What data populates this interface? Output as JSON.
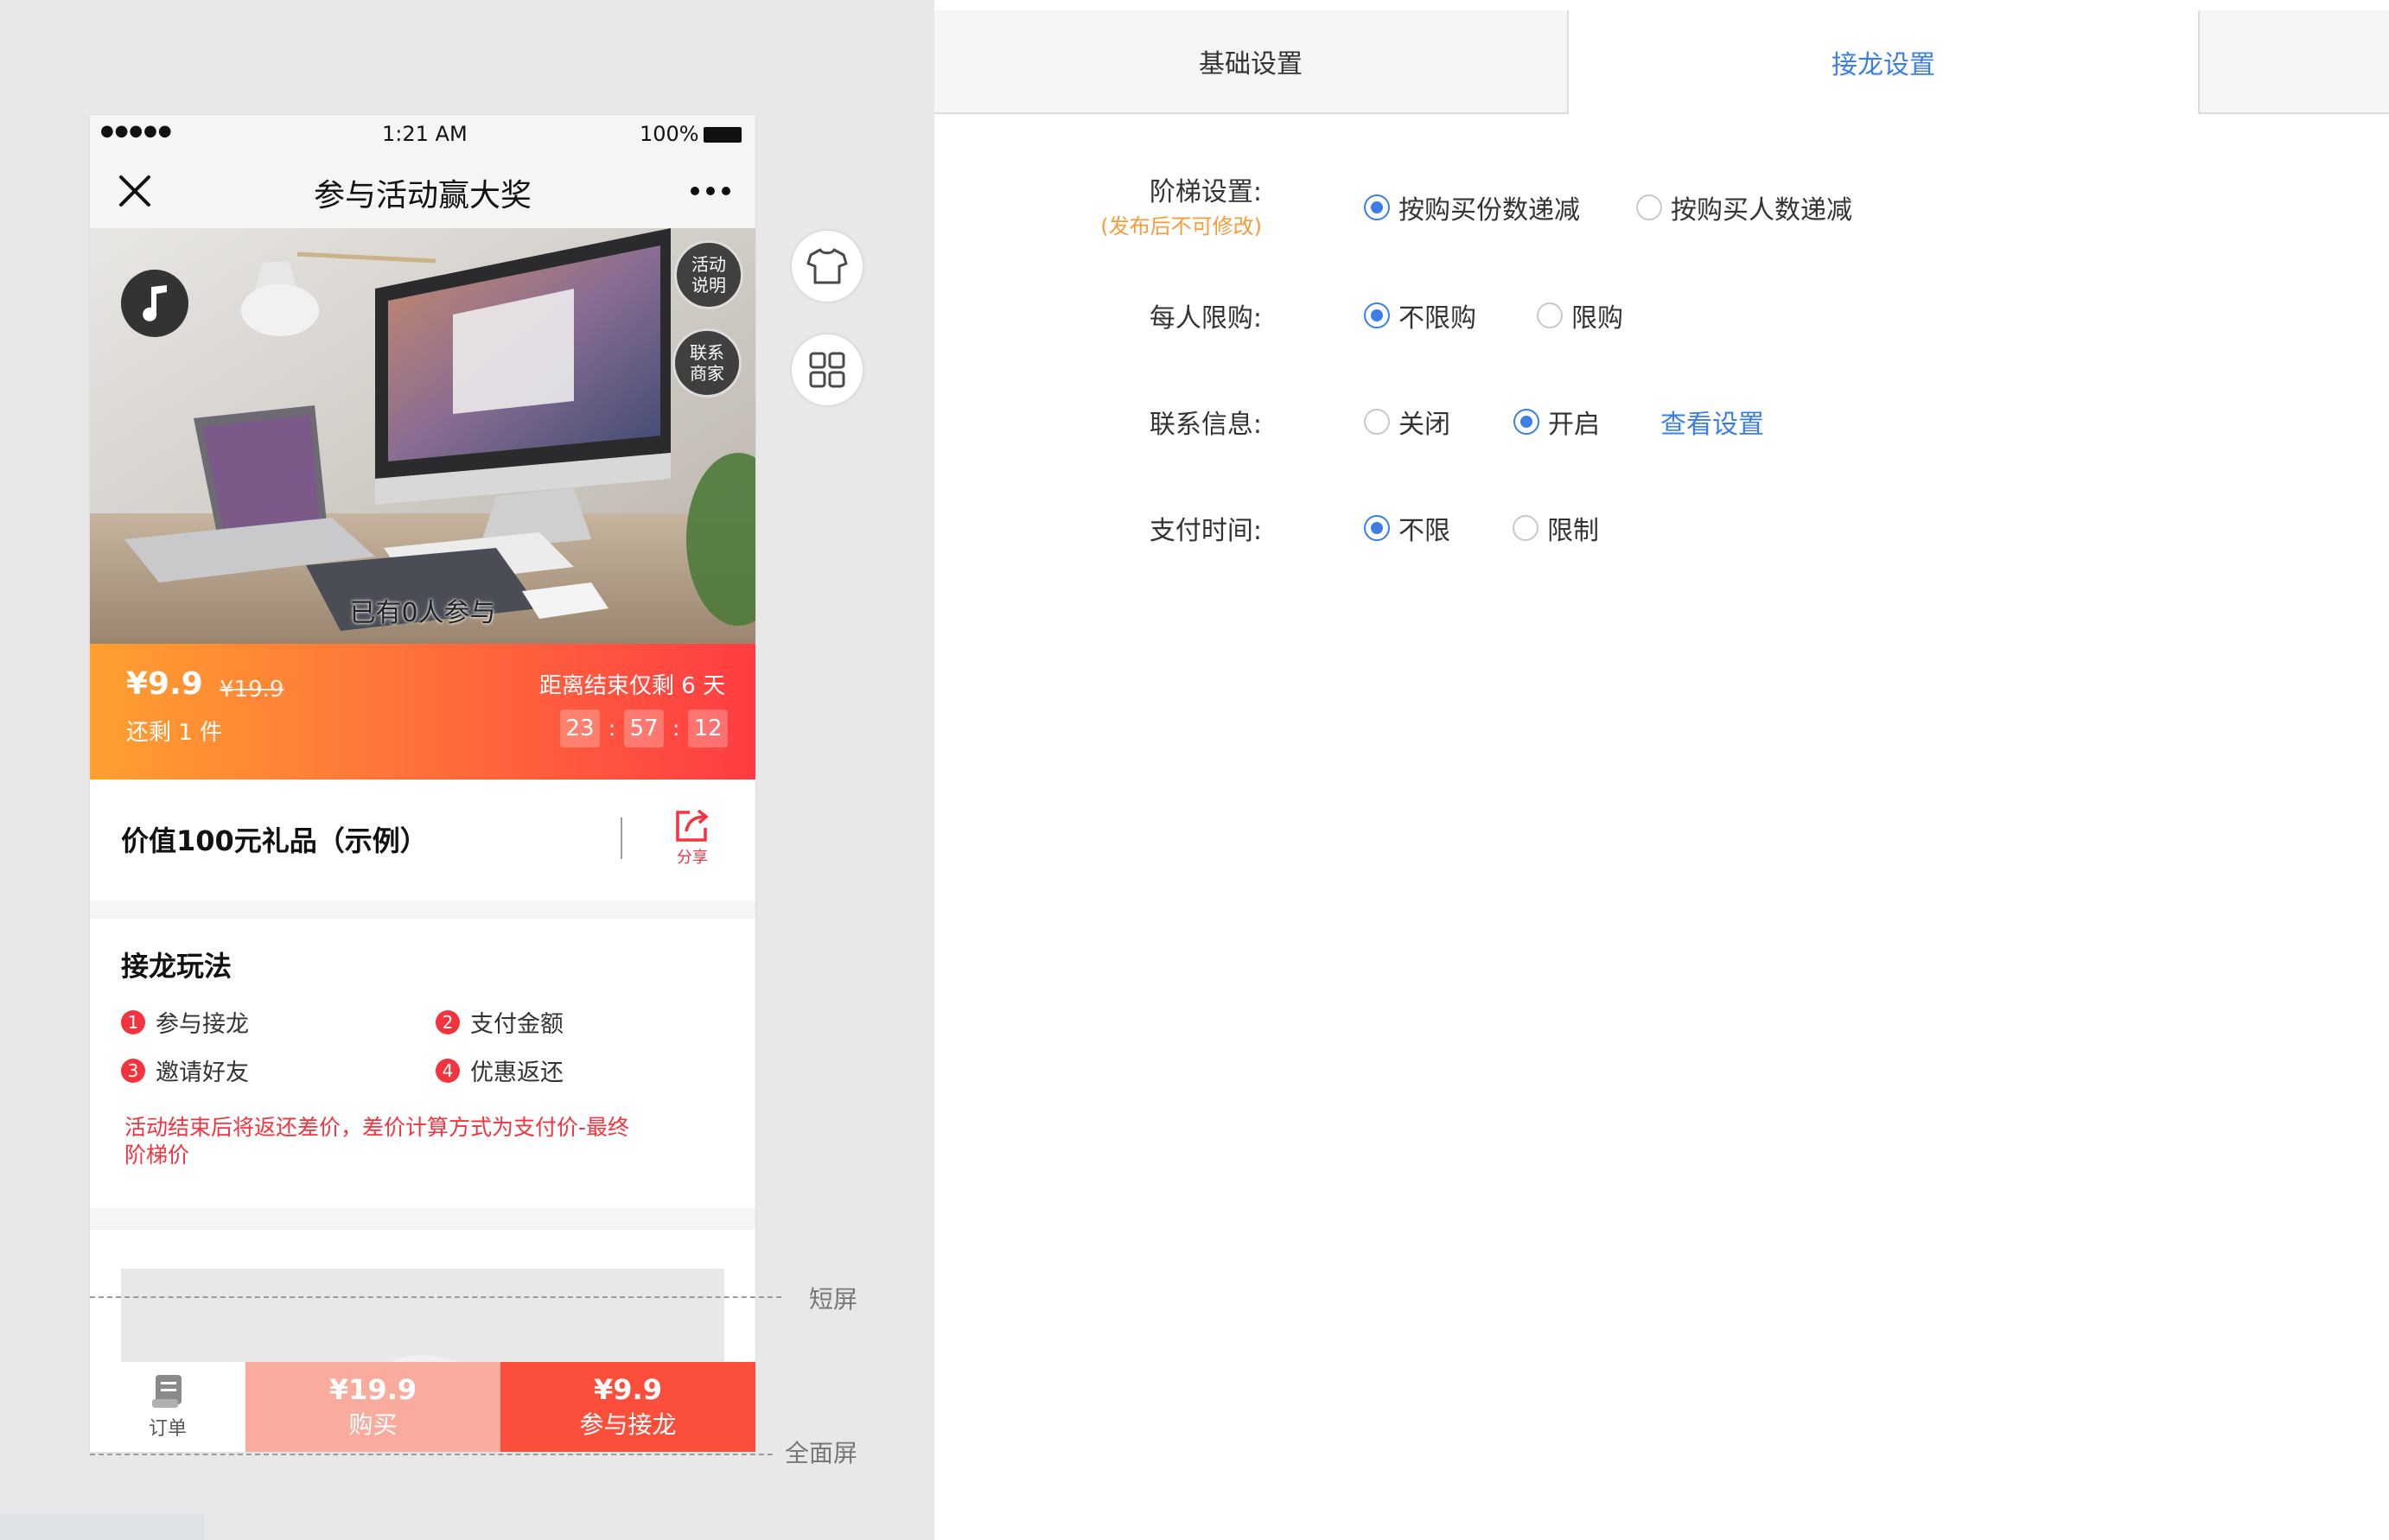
{
  "status_bar": {
    "signal": "●●●●●",
    "time": "1:21 AM",
    "battery": "100%"
  },
  "nav": {
    "title": "参与活动赢大奖",
    "close_icon": "close-icon",
    "more_icon": "more-icon"
  },
  "hero": {
    "badge_activity": [
      "活动",
      "说明"
    ],
    "badge_contact": [
      "联系",
      "商家"
    ],
    "participants": "已有0人参与"
  },
  "price_bar": {
    "price": "¥9.9",
    "original_price": "¥19.9",
    "remaining": "还剩 1 件",
    "countdown_label": "距离结束仅剩 6 天",
    "hours": "23",
    "minutes": "57",
    "seconds": "12",
    "sep": ":"
  },
  "product": {
    "title": "价值100元礼品（示例）",
    "share_label": "分享"
  },
  "rules": {
    "heading": "接龙玩法",
    "steps": [
      {
        "n": "1",
        "label": "参与接龙"
      },
      {
        "n": "2",
        "label": "支付金额"
      },
      {
        "n": "3",
        "label": "邀请好友"
      },
      {
        "n": "4",
        "label": "优惠返还"
      }
    ],
    "note_line1": "活动结束后将返还差价，差价计算方式为支付价-最终",
    "note_line2": "阶梯价"
  },
  "bottom_bar": {
    "orders_label": "订单",
    "buy_price": "¥19.9",
    "buy_label": "购买",
    "join_price": "¥9.9",
    "join_label": "参与接龙"
  },
  "guides": {
    "short_screen": "短屏",
    "full_screen": "全面屏"
  },
  "tabs": [
    {
      "label": "基础设置"
    },
    {
      "label": "接龙设置"
    }
  ],
  "form": {
    "tier": {
      "label": "阶梯设置:",
      "note": "(发布后不可修改)",
      "options": [
        "按购买份数递减",
        "按购买人数递减"
      ],
      "selected": 0
    },
    "limit": {
      "label": "每人限购:",
      "options": [
        "不限购",
        "限购"
      ],
      "selected": 0
    },
    "contact": {
      "label": "联系信息:",
      "options": [
        "关闭",
        "开启"
      ],
      "selected": 1,
      "link": "查看设置"
    },
    "pay_time": {
      "label": "支付时间:",
      "options": [
        "不限",
        "限制"
      ],
      "selected": 0
    }
  },
  "colors": {
    "accent": "#3a7ee6",
    "price_red": "#f5333f",
    "warn_orange": "#f79b3b"
  }
}
